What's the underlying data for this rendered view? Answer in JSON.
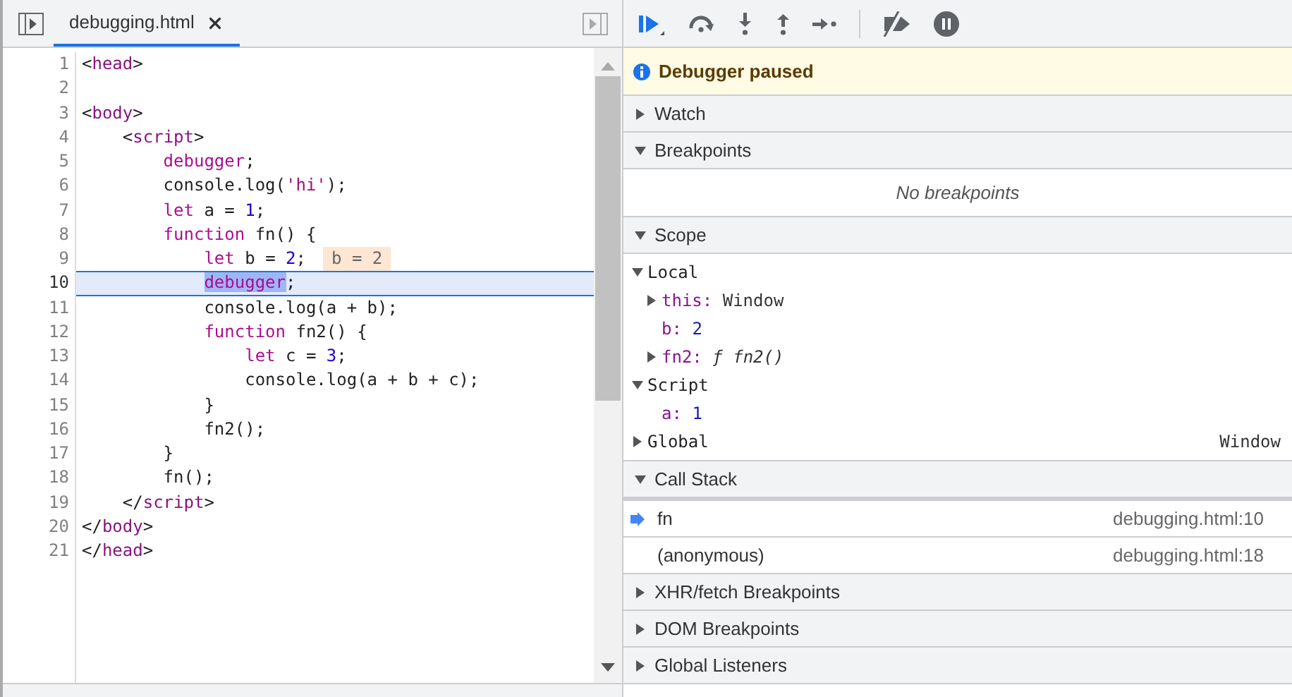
{
  "editor": {
    "tab": {
      "label": "debugging.html",
      "selected": true
    },
    "lines": [
      {
        "number": "1",
        "current": false,
        "tokens": [
          {
            "text": "<",
            "kind": "plain"
          },
          {
            "text": "head",
            "kind": "tag"
          },
          {
            "text": ">",
            "kind": "plain"
          }
        ]
      },
      {
        "number": "2",
        "current": false
      },
      {
        "number": "3",
        "current": false,
        "tokens": [
          {
            "text": "<",
            "kind": "plain"
          },
          {
            "text": "body",
            "kind": "tag"
          },
          {
            "text": ">",
            "kind": "plain"
          }
        ]
      },
      {
        "number": "4",
        "current": false,
        "tokens": [
          {
            "text": "    <",
            "kind": "plain"
          },
          {
            "text": "script",
            "kind": "tag"
          },
          {
            "text": ">",
            "kind": "plain"
          }
        ]
      },
      {
        "number": "5",
        "current": false,
        "tokens": [
          {
            "text": "        debugger",
            "kind": "keyword"
          },
          {
            "text": ";",
            "kind": "plain"
          }
        ]
      },
      {
        "number": "6",
        "current": false,
        "tokens": [
          {
            "text": "        console.log(",
            "kind": "plain"
          },
          {
            "text": "'hi'",
            "kind": "string"
          },
          {
            "text": ");",
            "kind": "plain"
          }
        ]
      },
      {
        "number": "7",
        "current": false,
        "tokens": [
          {
            "text": "        let",
            "kind": "keyword"
          },
          {
            "text": " a = ",
            "kind": "plain"
          },
          {
            "text": "1",
            "kind": "number"
          },
          {
            "text": ";",
            "kind": "plain"
          }
        ]
      },
      {
        "number": "8",
        "current": false,
        "tokens": [
          {
            "text": "        function",
            "kind": "keyword"
          },
          {
            "text": " fn() {",
            "kind": "plain"
          }
        ]
      },
      {
        "number": "9",
        "current": false,
        "inline_value": "b = 2",
        "tokens": [
          {
            "text": "            let",
            "kind": "keyword"
          },
          {
            "text": " b = ",
            "kind": "plain"
          },
          {
            "text": "2",
            "kind": "number"
          },
          {
            "text": ";",
            "kind": "plain"
          }
        ]
      },
      {
        "number": "10",
        "current": true,
        "tokens": [
          {
            "text": "            debugger",
            "kind": "keyword",
            "highlighted": true
          },
          {
            "text": ";",
            "kind": "plain"
          }
        ]
      },
      {
        "number": "11",
        "current": false,
        "tokens": [
          {
            "text": "            console.log(a + b);",
            "kind": "plain"
          }
        ]
      },
      {
        "number": "12",
        "current": false,
        "tokens": [
          {
            "text": "            function",
            "kind": "keyword"
          },
          {
            "text": " fn2() {",
            "kind": "plain"
          }
        ]
      },
      {
        "number": "13",
        "current": false,
        "tokens": [
          {
            "text": "                let",
            "kind": "keyword"
          },
          {
            "text": " c = ",
            "kind": "plain"
          },
          {
            "text": "3",
            "kind": "number"
          },
          {
            "text": ";",
            "kind": "plain"
          }
        ]
      },
      {
        "number": "14",
        "current": false,
        "tokens": [
          {
            "text": "                console.log(a + b + c);",
            "kind": "plain"
          }
        ]
      },
      {
        "number": "15",
        "current": false,
        "tokens": [
          {
            "text": "            }",
            "kind": "plain"
          }
        ]
      },
      {
        "number": "16",
        "current": false,
        "tokens": [
          {
            "text": "            fn2();",
            "kind": "plain"
          }
        ]
      },
      {
        "number": "17",
        "current": false,
        "tokens": [
          {
            "text": "        }",
            "kind": "plain"
          }
        ]
      },
      {
        "number": "18",
        "current": false,
        "tokens": [
          {
            "text": "        fn();",
            "kind": "plain"
          }
        ]
      },
      {
        "number": "19",
        "current": false,
        "tokens": [
          {
            "text": "    </",
            "kind": "plain"
          },
          {
            "text": "script",
            "kind": "tag"
          },
          {
            "text": ">",
            "kind": "plain"
          }
        ]
      },
      {
        "number": "20",
        "current": false,
        "tokens": [
          {
            "text": "</",
            "kind": "plain"
          },
          {
            "text": "body",
            "kind": "tag"
          },
          {
            "text": ">",
            "kind": "plain"
          }
        ]
      },
      {
        "number": "21",
        "current": false,
        "tokens": [
          {
            "text": "</",
            "kind": "plain"
          },
          {
            "text": "head",
            "kind": "tag"
          },
          {
            "text": ">",
            "kind": "plain"
          }
        ]
      }
    ]
  },
  "sidebar": [
    {
      "kind": "banner",
      "title": "Debugger paused"
    },
    {
      "kind": "section",
      "title": "Watch",
      "expanded": false
    },
    {
      "kind": "section",
      "title": "Breakpoints",
      "expanded": true,
      "empty_message": "No breakpoints"
    },
    {
      "kind": "section",
      "title": "Scope",
      "expanded": true,
      "scopes": [
        {
          "name": "Local",
          "expanded": true,
          "children": [
            {
              "name": "this:",
              "value": "Window",
              "kind": "object",
              "expanded": false
            },
            {
              "name": "b:",
              "value": "2",
              "kind": "number"
            },
            {
              "name": "fn2:",
              "value": "ƒ fn2()",
              "kind": "function",
              "expanded": false
            }
          ]
        },
        {
          "name": "Script",
          "expanded": true,
          "children": [
            {
              "name": "a:",
              "value": "1",
              "kind": "number"
            }
          ]
        },
        {
          "name": "Global",
          "expanded": false,
          "value": "Window"
        }
      ]
    },
    {
      "kind": "section",
      "title": "Call Stack",
      "expanded": true,
      "frames": [
        {
          "name": "fn",
          "location": "debugging.html:10",
          "selected": true
        },
        {
          "name": "(anonymous)",
          "location": "debugging.html:18",
          "selected": false
        }
      ]
    },
    {
      "kind": "section",
      "title": "XHR/fetch Breakpoints",
      "expanded": false
    },
    {
      "kind": "section",
      "title": "DOM Breakpoints",
      "expanded": false
    },
    {
      "kind": "section",
      "title": "Global Listeners",
      "expanded": false
    }
  ]
}
